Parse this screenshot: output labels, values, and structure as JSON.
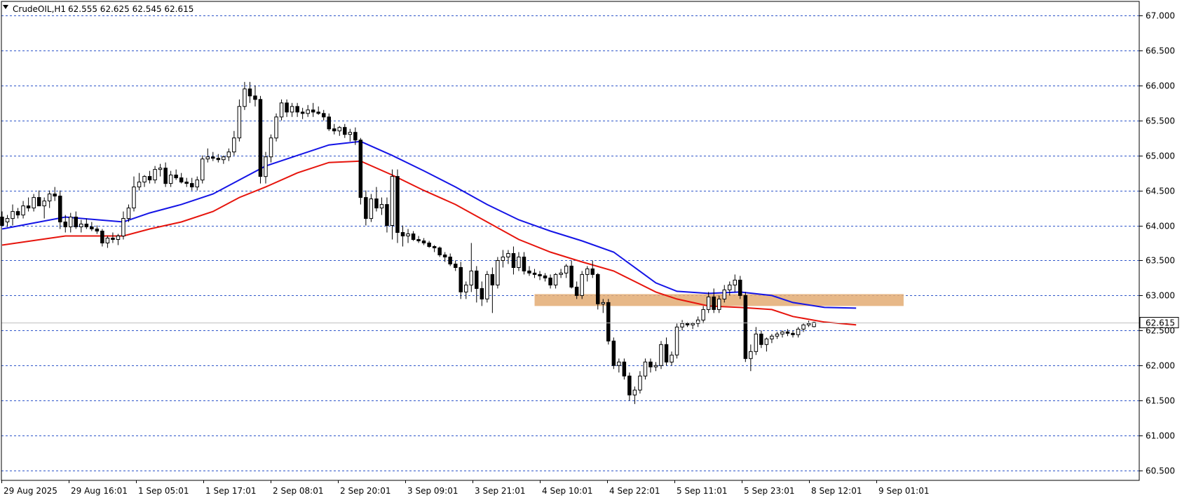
{
  "header": {
    "symbol": "CrudeOIL,H1",
    "ohlc": "62.555 62.625 62.545 62.615"
  },
  "colors": {
    "background": "#ffffff",
    "grid": "#2f56c9",
    "candle_up_fill": "#ffffff",
    "candle_down_fill": "#000000",
    "candle_outline": "#000000",
    "ma_fast": "#e6140c",
    "ma_slow": "#1414e6",
    "zone": "#e3ab73",
    "price_line": "#c0c0c0",
    "current_price_box": "#ffffff"
  },
  "chart_data": {
    "type": "candlestick",
    "symbol": "CrudeOIL",
    "timeframe": "H1",
    "ylim": [
      60.36,
      67.2
    ],
    "y_ticks": [
      "67.000",
      "66.500",
      "66.000",
      "65.500",
      "65.000",
      "64.500",
      "64.000",
      "63.500",
      "63.000",
      "62.500",
      "62.000",
      "61.500",
      "61.000",
      "60.500"
    ],
    "current_price": "62.615",
    "x_labels": [
      "29 Aug 2025",
      "29 Aug 16:01",
      "1 Sep 05:01",
      "1 Sep 17:01",
      "2 Sep 08:01",
      "2 Sep 20:01",
      "3 Sep 09:01",
      "3 Sep 21:01",
      "4 Sep 10:01",
      "4 Sep 22:01",
      "5 Sep 11:01",
      "5 Sep 23:01",
      "8 Sep 12:01",
      "9 Sep 01:01"
    ],
    "candle_width_bars": 0.6,
    "candles": [
      [
        64.12,
        64.2,
        64.08,
        64.0
      ],
      [
        64.05,
        64.15,
        63.98,
        64.1
      ],
      [
        64.1,
        64.3,
        64.0,
        64.2
      ],
      [
        64.2,
        64.25,
        64.1,
        64.15
      ],
      [
        64.15,
        64.35,
        64.1,
        64.28
      ],
      [
        64.28,
        64.4,
        64.2,
        64.25
      ],
      [
        64.25,
        64.45,
        64.2,
        64.4
      ],
      [
        64.4,
        64.5,
        64.3,
        64.28
      ],
      [
        64.28,
        64.4,
        64.1,
        64.35
      ],
      [
        64.35,
        64.5,
        64.25,
        64.45
      ],
      [
        64.45,
        64.55,
        64.35,
        64.42
      ],
      [
        64.42,
        64.5,
        63.95,
        64.05
      ],
      [
        64.05,
        64.15,
        63.9,
        63.98
      ],
      [
        63.98,
        64.18,
        63.9,
        64.12
      ],
      [
        64.12,
        64.2,
        63.95,
        63.98
      ],
      [
        63.98,
        64.08,
        63.9,
        64.02
      ],
      [
        64.02,
        64.1,
        63.95,
        63.98
      ],
      [
        63.98,
        64.05,
        63.92,
        63.95
      ],
      [
        63.95,
        64.0,
        63.88,
        63.92
      ],
      [
        63.92,
        63.95,
        63.7,
        63.75
      ],
      [
        63.75,
        63.85,
        63.68,
        63.82
      ],
      [
        63.82,
        63.9,
        63.75,
        63.8
      ],
      [
        63.8,
        63.88,
        63.72,
        63.85
      ],
      [
        63.85,
        64.2,
        63.8,
        64.1
      ],
      [
        64.1,
        64.3,
        64.05,
        64.25
      ],
      [
        64.25,
        64.7,
        64.2,
        64.55
      ],
      [
        64.55,
        64.75,
        64.5,
        64.62
      ],
      [
        64.62,
        64.72,
        64.55,
        64.7
      ],
      [
        64.7,
        64.78,
        64.6,
        64.65
      ],
      [
        64.65,
        64.85,
        64.6,
        64.8
      ],
      [
        64.8,
        64.88,
        64.7,
        64.82
      ],
      [
        64.82,
        64.9,
        64.55,
        64.6
      ],
      [
        64.6,
        64.78,
        64.55,
        64.72
      ],
      [
        64.72,
        64.8,
        64.65,
        64.68
      ],
      [
        64.68,
        64.75,
        64.6,
        64.62
      ],
      [
        64.62,
        64.68,
        64.55,
        64.6
      ],
      [
        64.6,
        64.68,
        64.5,
        64.55
      ],
      [
        64.55,
        64.7,
        64.5,
        64.65
      ],
      [
        64.65,
        65.0,
        64.6,
        64.95
      ],
      [
        64.95,
        65.1,
        64.9,
        64.98
      ],
      [
        64.98,
        65.05,
        64.92,
        64.96
      ],
      [
        64.96,
        65.02,
        64.9,
        64.94
      ],
      [
        64.94,
        65.0,
        64.88,
        64.98
      ],
      [
        64.98,
        65.1,
        64.92,
        65.05
      ],
      [
        65.05,
        65.35,
        65.0,
        65.25
      ],
      [
        65.25,
        65.8,
        65.2,
        65.7
      ],
      [
        65.7,
        66.05,
        65.65,
        65.95
      ],
      [
        65.95,
        66.05,
        65.75,
        65.85
      ],
      [
        65.85,
        66.0,
        65.7,
        65.8
      ],
      [
        65.8,
        65.85,
        64.6,
        64.7
      ],
      [
        64.7,
        65.05,
        64.6,
        64.98
      ],
      [
        64.98,
        65.3,
        64.9,
        65.25
      ],
      [
        65.25,
        65.6,
        65.2,
        65.55
      ],
      [
        65.55,
        65.8,
        65.5,
        65.75
      ],
      [
        65.75,
        65.8,
        65.55,
        65.62
      ],
      [
        65.62,
        65.75,
        65.55,
        65.7
      ],
      [
        65.7,
        65.75,
        65.55,
        65.62
      ],
      [
        65.62,
        65.68,
        65.52,
        65.6
      ],
      [
        65.6,
        65.72,
        65.55,
        65.65
      ],
      [
        65.65,
        65.75,
        65.55,
        65.62
      ],
      [
        65.62,
        65.7,
        65.58,
        65.6
      ],
      [
        65.6,
        65.65,
        65.5,
        65.55
      ],
      [
        65.55,
        65.6,
        65.35,
        65.38
      ],
      [
        65.38,
        65.45,
        65.3,
        65.35
      ],
      [
        65.35,
        65.42,
        65.28,
        65.4
      ],
      [
        65.4,
        65.45,
        65.25,
        65.3
      ],
      [
        65.3,
        65.38,
        65.2,
        65.33
      ],
      [
        65.33,
        65.4,
        65.15,
        65.22
      ],
      [
        65.22,
        65.25,
        64.3,
        64.4
      ],
      [
        64.4,
        64.5,
        64.0,
        64.1
      ],
      [
        64.1,
        64.45,
        64.05,
        64.38
      ],
      [
        64.38,
        64.55,
        64.2,
        64.25
      ],
      [
        64.25,
        64.4,
        64.15,
        64.3
      ],
      [
        64.3,
        64.4,
        63.9,
        64.0
      ],
      [
        64.0,
        64.8,
        63.8,
        64.7
      ],
      [
        64.7,
        64.8,
        63.75,
        63.9
      ],
      [
        63.9,
        64.0,
        63.7,
        63.85
      ],
      [
        63.85,
        63.95,
        63.75,
        63.88
      ],
      [
        63.88,
        63.92,
        63.78,
        63.8
      ],
      [
        63.8,
        63.85,
        63.75,
        63.78
      ],
      [
        63.78,
        63.82,
        63.72,
        63.75
      ],
      [
        63.75,
        63.78,
        63.68,
        63.7
      ],
      [
        63.7,
        63.72,
        63.62,
        63.68
      ],
      [
        63.68,
        63.7,
        63.55,
        63.58
      ],
      [
        63.58,
        63.62,
        63.48,
        63.55
      ],
      [
        63.55,
        63.6,
        63.42,
        63.45
      ],
      [
        63.45,
        63.5,
        63.35,
        63.4
      ],
      [
        63.4,
        63.48,
        62.95,
        63.05
      ],
      [
        63.05,
        63.2,
        62.95,
        63.15
      ],
      [
        63.15,
        63.75,
        63.05,
        63.35
      ],
      [
        63.35,
        63.42,
        62.9,
        63.1
      ],
      [
        63.1,
        63.2,
        62.85,
        62.95
      ],
      [
        62.95,
        63.35,
        62.9,
        63.3
      ],
      [
        63.3,
        63.4,
        62.75,
        63.15
      ],
      [
        63.15,
        63.55,
        63.1,
        63.5
      ],
      [
        63.5,
        63.65,
        63.4,
        63.55
      ],
      [
        63.55,
        63.65,
        63.45,
        63.6
      ],
      [
        63.6,
        63.7,
        63.3,
        63.4
      ],
      [
        63.4,
        63.62,
        63.35,
        63.55
      ],
      [
        63.55,
        63.62,
        63.3,
        63.35
      ],
      [
        63.35,
        63.42,
        63.28,
        63.32
      ],
      [
        63.32,
        63.38,
        63.25,
        63.3
      ],
      [
        63.3,
        63.35,
        63.22,
        63.28
      ],
      [
        63.28,
        63.32,
        63.2,
        63.25
      ],
      [
        63.25,
        63.3,
        63.1,
        63.15
      ],
      [
        63.15,
        63.32,
        63.1,
        63.3
      ],
      [
        63.3,
        63.38,
        63.25,
        63.32
      ],
      [
        63.32,
        63.45,
        63.25,
        63.42
      ],
      [
        63.42,
        63.5,
        63.1,
        63.12
      ],
      [
        63.12,
        63.2,
        62.95,
        63.0
      ],
      [
        63.0,
        63.35,
        62.95,
        63.3
      ],
      [
        63.3,
        63.42,
        63.2,
        63.38
      ],
      [
        63.38,
        63.5,
        63.25,
        63.3
      ],
      [
        63.3,
        63.32,
        62.8,
        62.88
      ],
      [
        62.88,
        62.95,
        62.75,
        62.9
      ],
      [
        62.9,
        62.95,
        62.3,
        62.35
      ],
      [
        62.35,
        62.4,
        61.95,
        62.0
      ],
      [
        62.0,
        62.1,
        61.9,
        62.05
      ],
      [
        62.05,
        62.1,
        61.8,
        61.85
      ],
      [
        61.85,
        61.9,
        61.5,
        61.58
      ],
      [
        61.58,
        61.7,
        61.45,
        61.65
      ],
      [
        61.65,
        61.92,
        61.6,
        61.85
      ],
      [
        61.85,
        62.1,
        61.8,
        62.05
      ],
      [
        62.05,
        62.1,
        61.9,
        61.98
      ],
      [
        61.98,
        62.05,
        61.92,
        62.0
      ],
      [
        62.0,
        62.35,
        61.95,
        62.3
      ],
      [
        62.3,
        62.4,
        62.0,
        62.05
      ],
      [
        62.05,
        62.2,
        62.0,
        62.15
      ],
      [
        62.15,
        62.6,
        62.1,
        62.55
      ],
      [
        62.55,
        62.65,
        62.5,
        62.6
      ],
      [
        62.6,
        62.62,
        62.55,
        62.58
      ],
      [
        62.58,
        62.62,
        62.52,
        62.6
      ],
      [
        62.6,
        62.7,
        62.55,
        62.65
      ],
      [
        62.65,
        62.85,
        62.6,
        62.8
      ],
      [
        62.8,
        63.05,
        62.75,
        62.98
      ],
      [
        62.98,
        63.1,
        62.75,
        62.8
      ],
      [
        62.8,
        63.0,
        62.75,
        62.95
      ],
      [
        62.95,
        63.15,
        62.9,
        63.08
      ],
      [
        63.08,
        63.2,
        63.0,
        63.15
      ],
      [
        63.15,
        63.3,
        63.05,
        63.22
      ],
      [
        63.22,
        63.28,
        62.95,
        63.0
      ],
      [
        63.0,
        63.05,
        62.05,
        62.1
      ],
      [
        62.1,
        62.3,
        61.92,
        62.2
      ],
      [
        62.2,
        62.55,
        62.15,
        62.45
      ],
      [
        62.45,
        62.5,
        62.25,
        62.3
      ],
      [
        62.3,
        62.4,
        62.2,
        62.38
      ],
      [
        62.38,
        62.45,
        62.32,
        62.42
      ],
      [
        62.42,
        62.48,
        62.38,
        62.45
      ],
      [
        62.45,
        62.5,
        62.4,
        62.48
      ],
      [
        62.48,
        62.52,
        62.42,
        62.46
      ],
      [
        62.46,
        62.5,
        62.4,
        62.44
      ],
      [
        62.44,
        62.55,
        62.4,
        62.52
      ],
      [
        62.52,
        62.6,
        62.48,
        62.58
      ],
      [
        62.58,
        62.64,
        62.55,
        62.6
      ],
      [
        62.555,
        62.625,
        62.545,
        62.615
      ]
    ],
    "ma_fast": [
      [
        0,
        63.72
      ],
      [
        12,
        63.85
      ],
      [
        23,
        63.85
      ],
      [
        28,
        63.95
      ],
      [
        34,
        64.05
      ],
      [
        40,
        64.2
      ],
      [
        45,
        64.4
      ],
      [
        50,
        64.55
      ],
      [
        56,
        64.75
      ],
      [
        62,
        64.9
      ],
      [
        68,
        64.92
      ],
      [
        74,
        64.72
      ],
      [
        80,
        64.5
      ],
      [
        86,
        64.3
      ],
      [
        92,
        64.05
      ],
      [
        98,
        63.8
      ],
      [
        104,
        63.62
      ],
      [
        110,
        63.48
      ],
      [
        116,
        63.35
      ],
      [
        120,
        63.2
      ],
      [
        124,
        63.05
      ],
      [
        128,
        62.95
      ],
      [
        134,
        62.85
      ],
      [
        140,
        62.83
      ],
      [
        146,
        62.8
      ],
      [
        150,
        62.7
      ],
      [
        156,
        62.62
      ],
      [
        162,
        62.58
      ]
    ],
    "ma_slow": [
      [
        0,
        63.95
      ],
      [
        12,
        64.12
      ],
      [
        23,
        64.05
      ],
      [
        28,
        64.18
      ],
      [
        34,
        64.3
      ],
      [
        40,
        64.45
      ],
      [
        45,
        64.65
      ],
      [
        50,
        64.85
      ],
      [
        56,
        65.0
      ],
      [
        62,
        65.15
      ],
      [
        68,
        65.2
      ],
      [
        74,
        65.0
      ],
      [
        80,
        64.78
      ],
      [
        86,
        64.55
      ],
      [
        92,
        64.3
      ],
      [
        98,
        64.08
      ],
      [
        104,
        63.92
      ],
      [
        110,
        63.78
      ],
      [
        116,
        63.62
      ],
      [
        120,
        63.4
      ],
      [
        124,
        63.18
      ],
      [
        128,
        63.06
      ],
      [
        134,
        63.03
      ],
      [
        140,
        63.05
      ],
      [
        146,
        63.0
      ],
      [
        150,
        62.9
      ],
      [
        156,
        62.83
      ],
      [
        162,
        62.82
      ]
    ],
    "zone": {
      "x_start": 101,
      "x_end": 171,
      "y_low": 62.85,
      "y_high": 63.02
    }
  }
}
